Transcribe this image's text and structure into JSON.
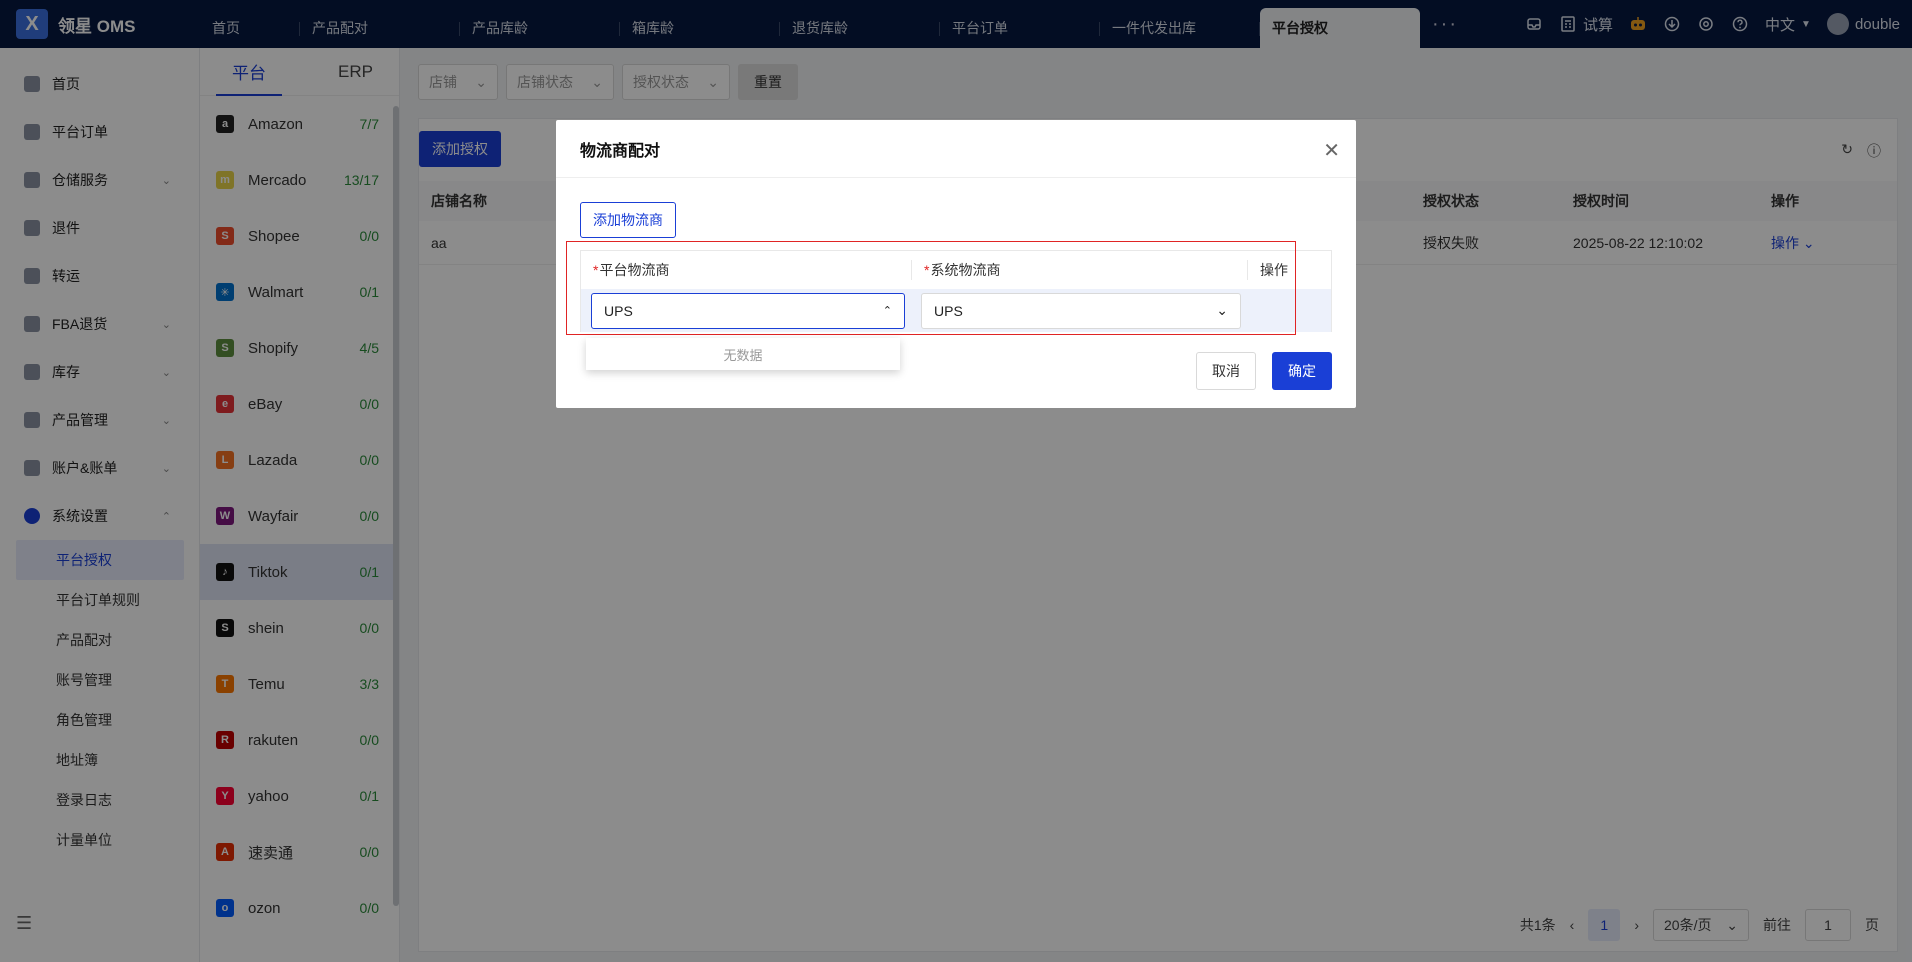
{
  "app": {
    "title": "领星 OMS",
    "logo_letter": "X"
  },
  "tabs": [
    {
      "label": "首页"
    },
    {
      "label": "产品配对"
    },
    {
      "label": "产品库龄"
    },
    {
      "label": "箱库龄"
    },
    {
      "label": "退货库龄"
    },
    {
      "label": "平台订单"
    },
    {
      "label": "一件代发出库"
    },
    {
      "label": "平台授权"
    }
  ],
  "topright": {
    "more": "···",
    "calc_label": "试算",
    "language": "中文",
    "username": "double"
  },
  "sidebar": {
    "items": [
      {
        "label": "首页",
        "icon": "home-icon"
      },
      {
        "label": "平台订单",
        "icon": "order-icon"
      },
      {
        "label": "仓储服务",
        "icon": "warehouse-icon",
        "arrow": "⌄"
      },
      {
        "label": "退件",
        "icon": "return-icon"
      },
      {
        "label": "转运",
        "icon": "transfer-icon"
      },
      {
        "label": "FBA退货",
        "icon": "fba-icon",
        "arrow": "⌄"
      },
      {
        "label": "库存",
        "icon": "inventory-icon",
        "arrow": "⌄"
      },
      {
        "label": "产品管理",
        "icon": "product-icon",
        "arrow": "⌄"
      },
      {
        "label": "账户&账单",
        "icon": "account-icon",
        "arrow": "⌄"
      },
      {
        "label": "系统设置",
        "icon": "settings-icon",
        "arrow": "⌃"
      }
    ],
    "sub_items": [
      "平台授权",
      "平台订单规则",
      "产品配对",
      "账号管理",
      "角色管理",
      "地址簿",
      "登录日志",
      "计量单位"
    ]
  },
  "platform_tabs": {
    "platform": "平台",
    "erp": "ERP"
  },
  "platforms": [
    {
      "name": "Amazon",
      "count": "7/7",
      "color": "#222",
      "glyph": "a"
    },
    {
      "name": "Mercado",
      "count": "13/17",
      "color": "#e8d44a",
      "glyph": "m"
    },
    {
      "name": "Shopee",
      "count": "0/0",
      "color": "#ee4d2d",
      "glyph": "S"
    },
    {
      "name": "Walmart",
      "count": "0/1",
      "color": "#0071ce",
      "glyph": "✳"
    },
    {
      "name": "Shopify",
      "count": "4/5",
      "color": "#5e8e3e",
      "glyph": "S"
    },
    {
      "name": "eBay",
      "count": "0/0",
      "color": "#e53238",
      "glyph": "e"
    },
    {
      "name": "Lazada",
      "count": "0/0",
      "color": "#f57224",
      "glyph": "L"
    },
    {
      "name": "Wayfair",
      "count": "0/0",
      "color": "#7f187f",
      "glyph": "W"
    },
    {
      "name": "Tiktok",
      "count": "0/1",
      "color": "#111",
      "glyph": "♪"
    },
    {
      "name": "shein",
      "count": "0/0",
      "color": "#111",
      "glyph": "S"
    },
    {
      "name": "Temu",
      "count": "3/3",
      "color": "#fb7701",
      "glyph": "T"
    },
    {
      "name": "rakuten",
      "count": "0/0",
      "color": "#bf0000",
      "glyph": "R"
    },
    {
      "name": "yahoo",
      "count": "0/1",
      "color": "#ff0033",
      "glyph": "Y"
    },
    {
      "name": "速卖通",
      "count": "0/0",
      "color": "#e62e04",
      "glyph": "A"
    },
    {
      "name": "ozon",
      "count": "0/0",
      "color": "#005bff",
      "glyph": "o"
    }
  ],
  "filters": {
    "shop": "店铺",
    "shop_status": "店铺状态",
    "auth_status": "授权状态",
    "reset": "重置"
  },
  "table": {
    "add_auth": "添加授权",
    "headers": {
      "shop_name": "店铺名称",
      "auth_status": "授权状态",
      "auth_time": "授权时间",
      "actions": "操作"
    },
    "rows": [
      {
        "shop_name": "aa",
        "auth_status": "授权失败",
        "auth_time": "2025-08-22 12:10:02",
        "action": "操作"
      }
    ]
  },
  "pager": {
    "total": "共1条",
    "current": "1",
    "page_size": "20条/页",
    "goto": "前往",
    "goto_value": "1",
    "page_suffix": "页"
  },
  "dialog": {
    "title": "物流商配对",
    "add_carrier": "添加物流商",
    "col_platform": "平台物流商",
    "col_system": "系统物流商",
    "col_action": "操作",
    "platform_value": "UPS",
    "system_value": "UPS",
    "no_data": "无数据",
    "cancel": "取消",
    "confirm": "确定",
    "required_mark": "*"
  },
  "colors": {
    "primary": "#1a3fd6",
    "topbar": "#061840",
    "highlight": "#e02424"
  }
}
